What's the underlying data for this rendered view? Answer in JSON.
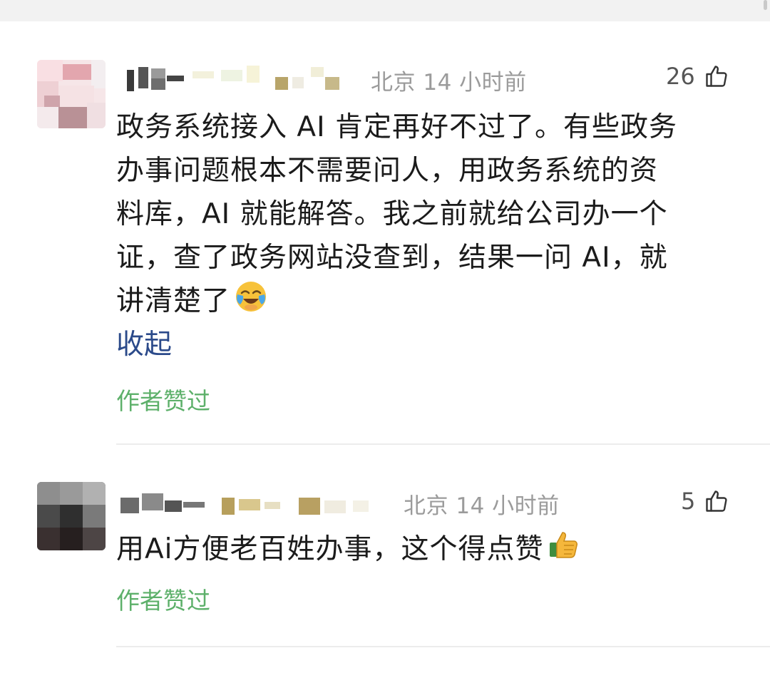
{
  "comments": [
    {
      "location_time": "北京 14 小时前",
      "like_count": "26",
      "like_icon": "thumbs-up-outline-icon",
      "text_lines": [
        "政务系统接入 AI 肯定再好不过了。有些政务",
        "办事问题根本不需要问人，用政务系统的资",
        "料库，AI 就能解答。我之前就给公司办一个",
        "证，查了政务网站没查到，结果一问 AI，就",
        "讲清楚了"
      ],
      "emoji": "laughing-crying-face-emoji",
      "collapse_label": "收起",
      "author_liked": "作者赞过"
    },
    {
      "location_time": "北京 14 小时前",
      "like_count": "5",
      "like_icon": "thumbs-up-outline-icon",
      "text_lines": [
        "用Ai方便老百姓办事，这个得点赞"
      ],
      "emoji": "thumbs-up-emoji",
      "author_liked": "作者赞过"
    }
  ],
  "colors": {
    "meta_gray": "#9b9b9b",
    "link_blue": "#2b4a8a",
    "author_liked_green": "#5db06a",
    "divider": "#ececec"
  }
}
